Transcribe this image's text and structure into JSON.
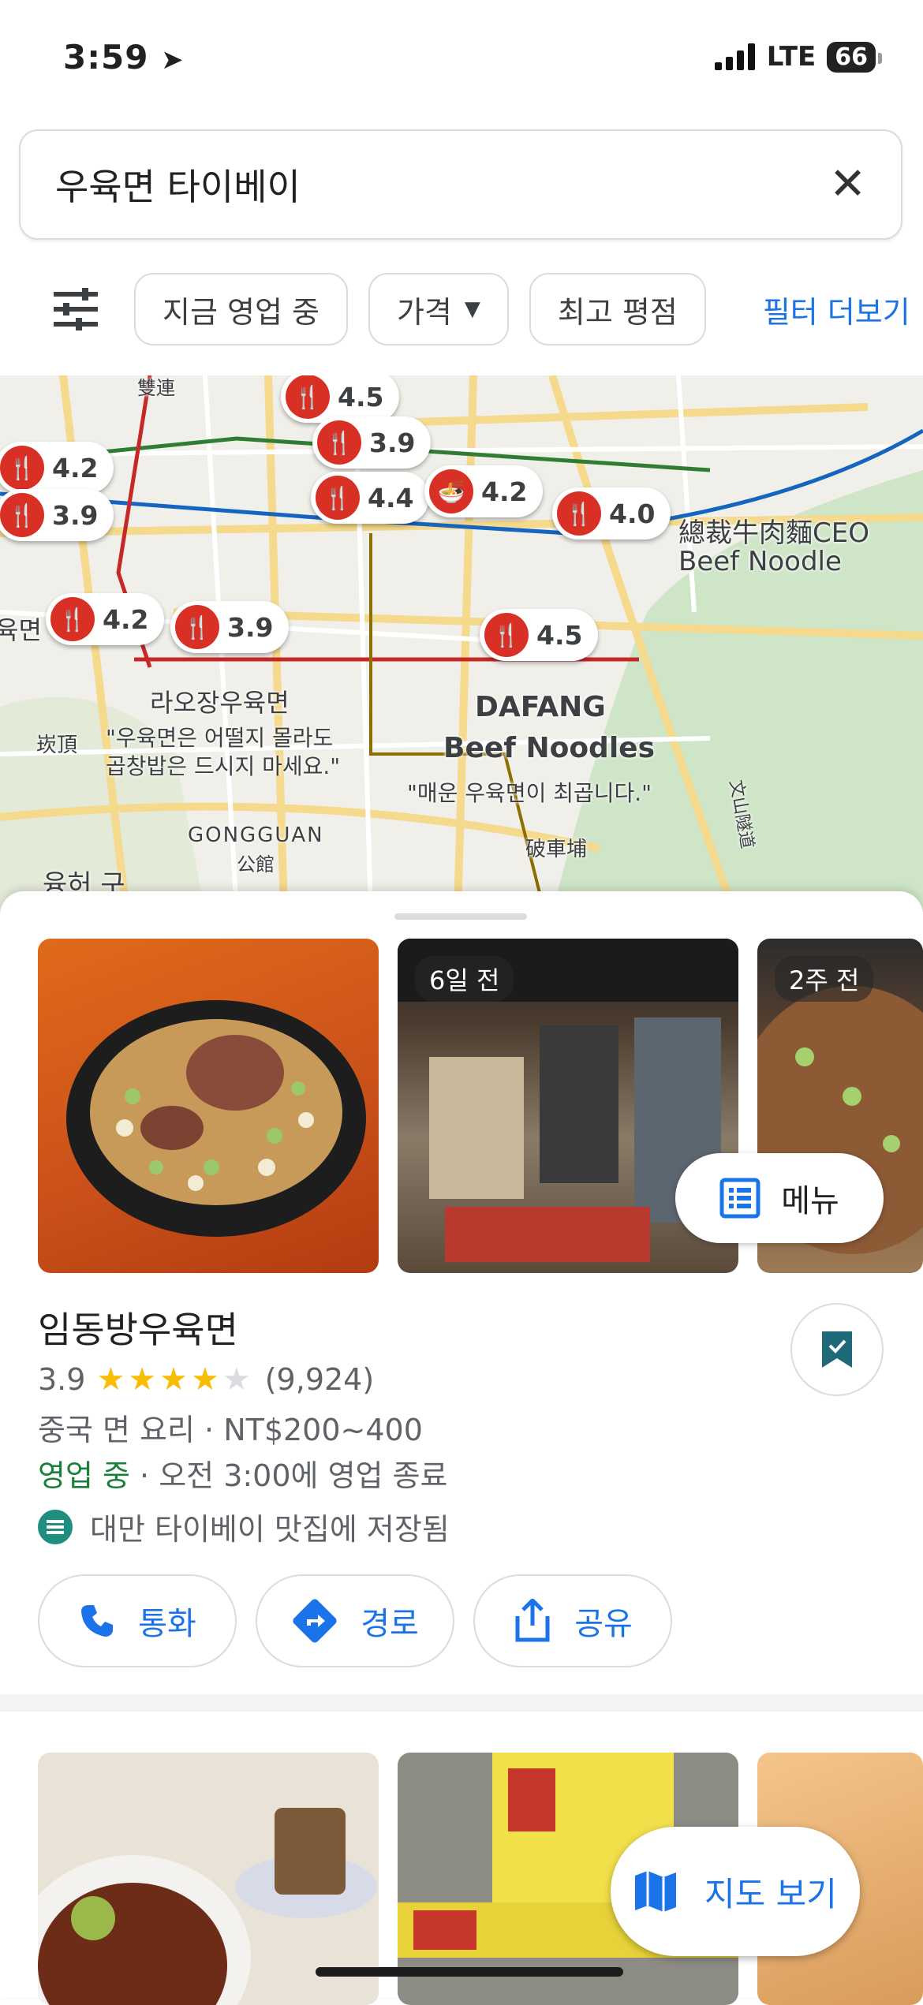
{
  "status": {
    "time": "3:59",
    "network": "LTE",
    "battery": "66"
  },
  "search": {
    "query": "우육면 타이베이"
  },
  "chips": [
    "지금 영업 중",
    "가격",
    "최고 평점"
  ],
  "chip_more": "필터 더보기",
  "map": {
    "pins": [
      "4.5",
      "3.9",
      "4.2",
      "3.9",
      "4.4",
      "4.2",
      "4.0",
      "4.2",
      "3.9",
      "4.5"
    ],
    "labels": {
      "ceo_cn": "總裁牛肉麵CEO",
      "ceo_en": "Beef Noodle",
      "laojiang": "라오장우육면",
      "laojiang_quote1": "\"우육면은 어떨지 몰라도",
      "laojiang_quote2": "곱창밥은 드시지 마세요.\"",
      "dafang1": "DAFANG",
      "dafang2": "Beef Noodles",
      "dafang_quote": "\"매운 우육면이 최곱니다.\"",
      "gongguan": "GONGGUAN",
      "gongguan_cn": "公館",
      "district": "융허 구",
      "top_cn": "雙連",
      "left_cn": "崁頂",
      "right_cn": "破車埔",
      "road_cn": "文山隧道",
      "left_edge": "육면"
    }
  },
  "place": {
    "photo_tags": [
      "6일 전",
      "2주 전"
    ],
    "menu_label": "메뉴",
    "name": "임동방우육면",
    "rating": "3.9",
    "stars": 3.9,
    "reviews": "(9,924)",
    "category": "중국 면 요리 · NT$200~400",
    "open_status": "영업 중",
    "hours": " · 오전 3:00에 영업 종료",
    "saved": "대만 타이베이 맛집에 저장됨",
    "actions": {
      "call": "통화",
      "directions": "경로",
      "share": "공유"
    }
  },
  "map_view_label": "지도 보기",
  "colors": {
    "accent": "#1a73e8",
    "open": "#188038",
    "pin": "#d93025",
    "star": "#fbbc04"
  }
}
